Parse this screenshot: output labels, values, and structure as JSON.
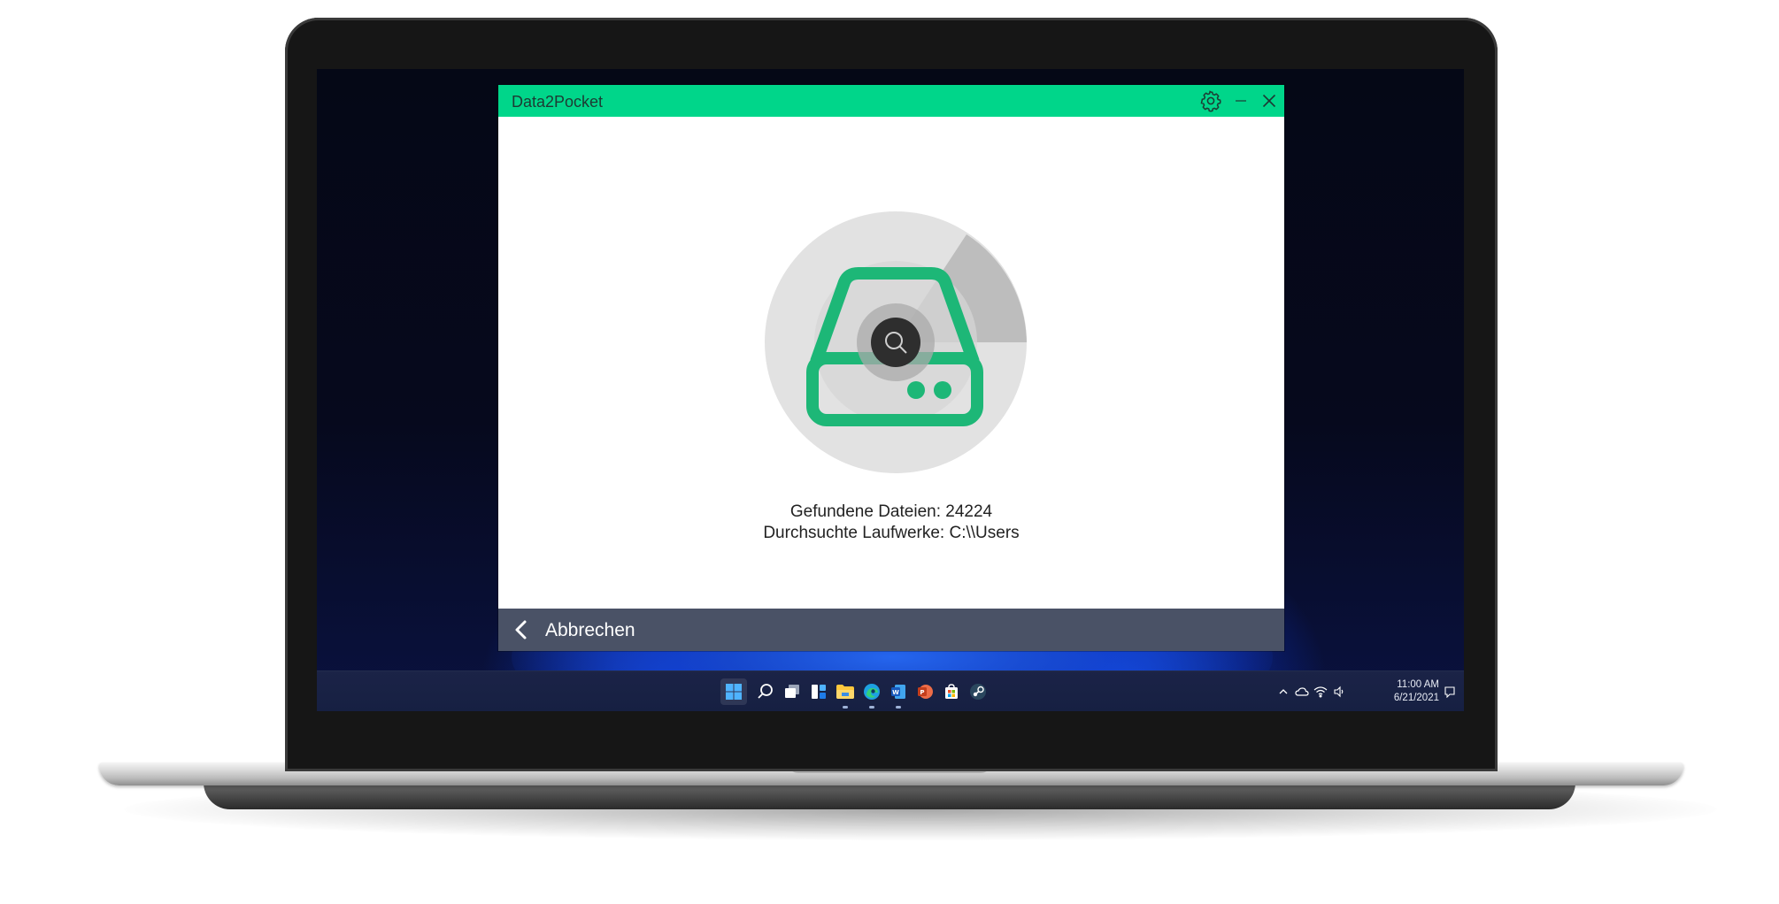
{
  "app": {
    "title": "Data2Pocket",
    "found_files_text": "Gefundene Dateien: 24224",
    "scanned_drives_text": "Durchsuchte Laufwerke: C:\\\\Users",
    "cancel_label": "Abbrechen",
    "accent_color": "#00d68a",
    "footer_color": "#4a5266",
    "icons": {
      "settings": "gear-icon",
      "minimize": "minimize-icon",
      "close": "close-icon",
      "back": "chevron-left-icon",
      "drive": "hard-drive-icon",
      "search": "search-icon"
    }
  },
  "taskbar": {
    "apps": [
      "start",
      "search",
      "task-view",
      "widgets",
      "file-explorer",
      "edge",
      "word",
      "powerpoint",
      "store",
      "steam"
    ],
    "tray": [
      "chevron-up",
      "onedrive",
      "wifi",
      "volume",
      "notifications"
    ],
    "time": "11:00 AM",
    "date": "6/21/2021"
  }
}
